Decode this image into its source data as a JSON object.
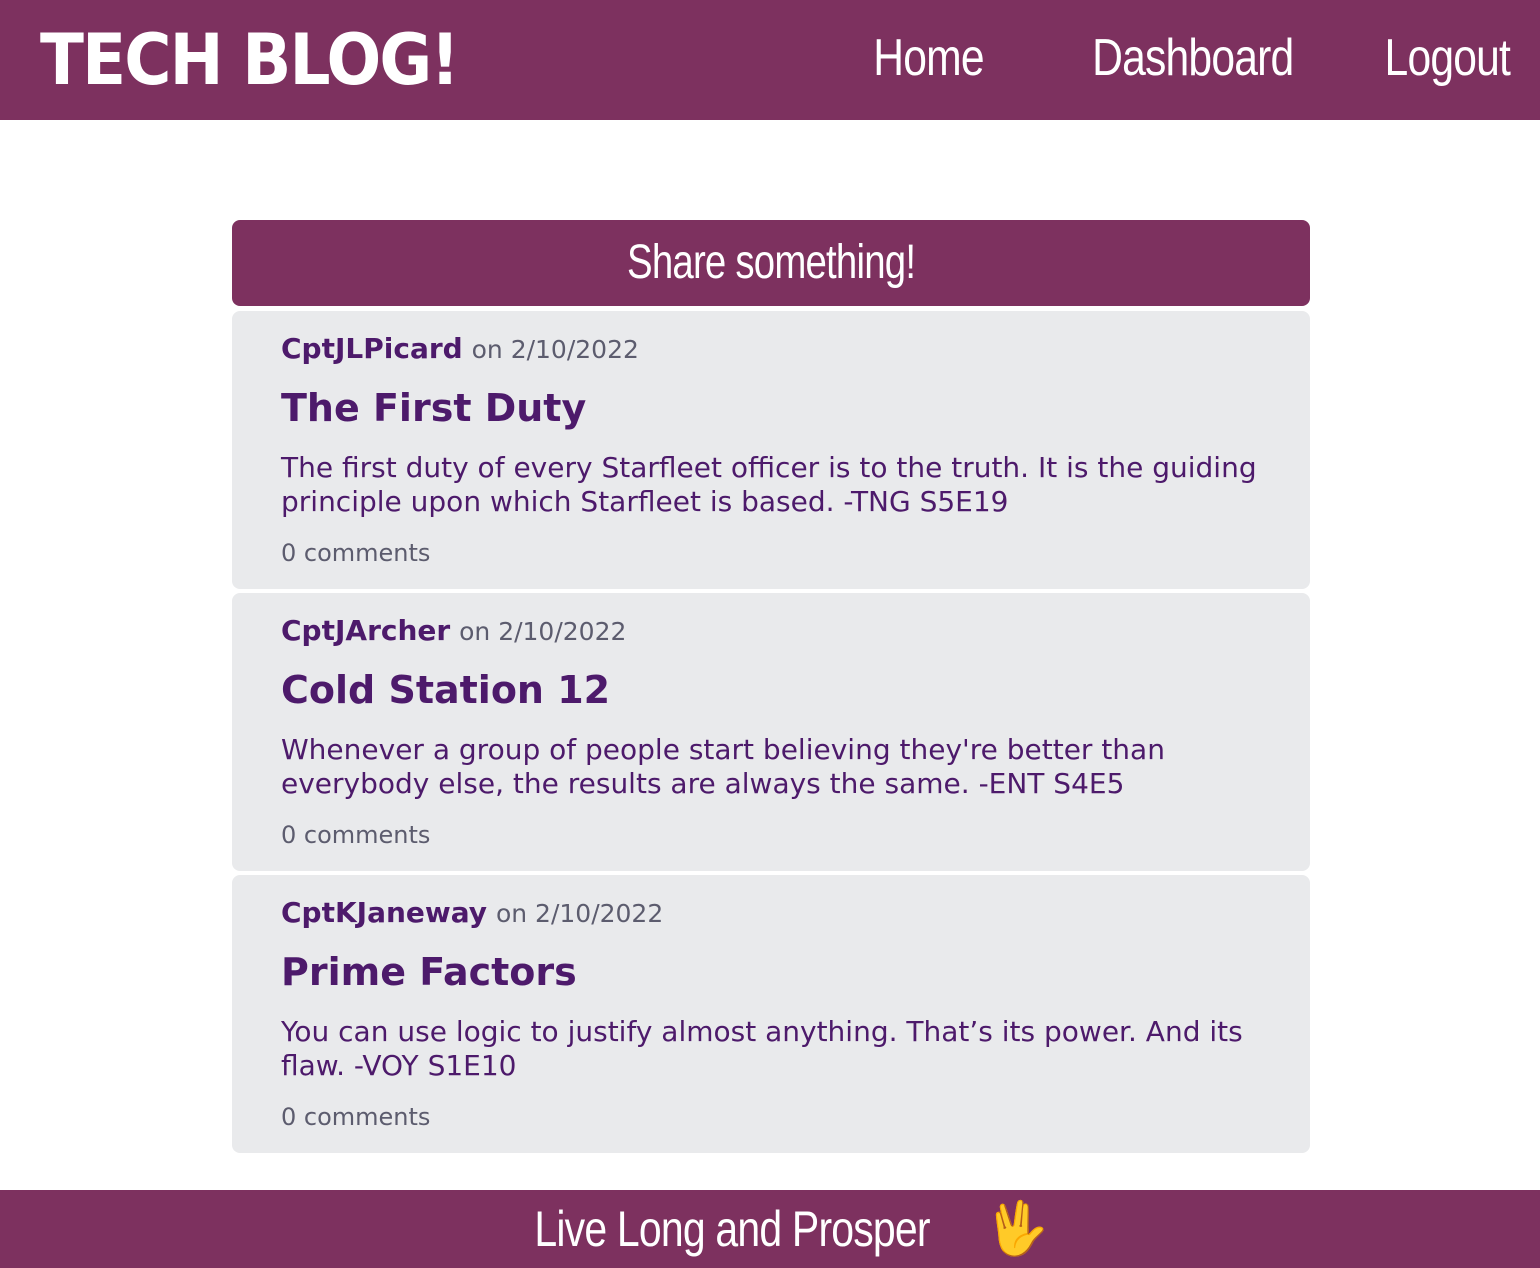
{
  "header": {
    "brand": "TECH BLOG!",
    "nav": [
      "Home",
      "Dashboard",
      "Logout"
    ]
  },
  "share": {
    "label": "Share something!"
  },
  "posts": [
    {
      "author": "CptJLPicard",
      "date": "on 2/10/2022",
      "title": "The First Duty",
      "body": "The first duty of every Starfleet officer is to the truth. It is the guiding principle upon which Starfleet is based. -TNG S5E19",
      "comments": "0 comments"
    },
    {
      "author": "CptJArcher",
      "date": "on 2/10/2022",
      "title": "Cold Station 12",
      "body": "Whenever a group of people start believing they're better than everybody else, the results are always the same. -ENT S4E5",
      "comments": "0 comments"
    },
    {
      "author": "CptKJaneway",
      "date": "on 2/10/2022",
      "title": "Prime Factors",
      "body": "You can use logic to justify almost anything. That’s its power. And its flaw. -VOY S1E10",
      "comments": "0 comments"
    }
  ],
  "footer": {
    "text": "Live Long and Prosper",
    "icon": "vulcan-salute-icon"
  },
  "colors": {
    "brand": "#7d315f",
    "card": "#e9eaec",
    "text": "#4d1a6b"
  }
}
